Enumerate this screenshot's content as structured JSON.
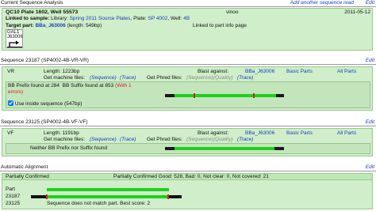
{
  "current_analysis": {
    "title": "Current Sequence Analysis",
    "add_link": "Add another sequence read",
    "edit": "Edit",
    "plate": "QC10 Plate 1602, Well 55573",
    "user": "vinoo",
    "date": "2011-05-12",
    "linked_label": "Linked to sample:",
    "library_label": "Library:",
    "library": "Spring 2011 Source Plates",
    "plate_label": "Plate:",
    "plate_link": "SP 4002",
    "well_label": "Well:",
    "well_link": "4B",
    "target_label": "Target part:",
    "target_part": "BBa_J63006",
    "target_length": "(length: 549bp)",
    "part_info": "Linked to part info page",
    "gal_lines": [
      "GAL1",
      "J63006"
    ]
  },
  "seq1": {
    "title": "Sequence 23187",
    "id": "(SP4002-4B-VR-VR)",
    "edit": "Edit",
    "dir": "VR",
    "length": "Length: 1223bp",
    "blast_label": "Blast against:",
    "blast_part": "BBa_J63006",
    "basic_parts": "Basic Parts",
    "all_parts": "All Parts",
    "machine_label": "Get machine files:",
    "sequence": "(Sequence)",
    "trace": "(Trace)",
    "phred_label": "Get Phred files:",
    "quality": "(Quality)",
    "prefix_text": "BB Prefix found at 284",
    "suffix_text": "BB Suffix found at 853",
    "with_text": "(With 1",
    "errors_text": "errors)",
    "checkbox_label": "Use inside sequence (547bp)"
  },
  "seq2": {
    "title": "Sequence 23125",
    "id": "(SP4002-4B-VF-VF)",
    "edit": "Edit",
    "dir": "VF",
    "length": "Length: 1191bp",
    "blast_label": "Blast against:",
    "blast_part": "BBa_J63006",
    "basic_parts": "Basic Parts",
    "all_parts": "All Parts",
    "machine_label": "Get machine files:",
    "sequence": "(Sequence)",
    "trace": "(Trace)",
    "phred_label": "Get Phred files:",
    "quality": "(Quality)",
    "neither_text": "Neither BB Prefix nor Suffix found"
  },
  "alignment": {
    "title": "Automatic Alignment",
    "edit": "Edit",
    "status": "Partially Confirmed",
    "summary": "Partially Confirmed Good: 528, Bad: 0, Not clear: 0, Not covered: 21",
    "part_label": "Part",
    "row1": "23187",
    "row2": "23125",
    "no_match": "Sequence does not match part. Best score: 2"
  },
  "colors": {
    "panel": "#cfeec9",
    "bar_green": "#1ed01e",
    "mark_red": "#d42020",
    "link": "#1a3fbf"
  }
}
